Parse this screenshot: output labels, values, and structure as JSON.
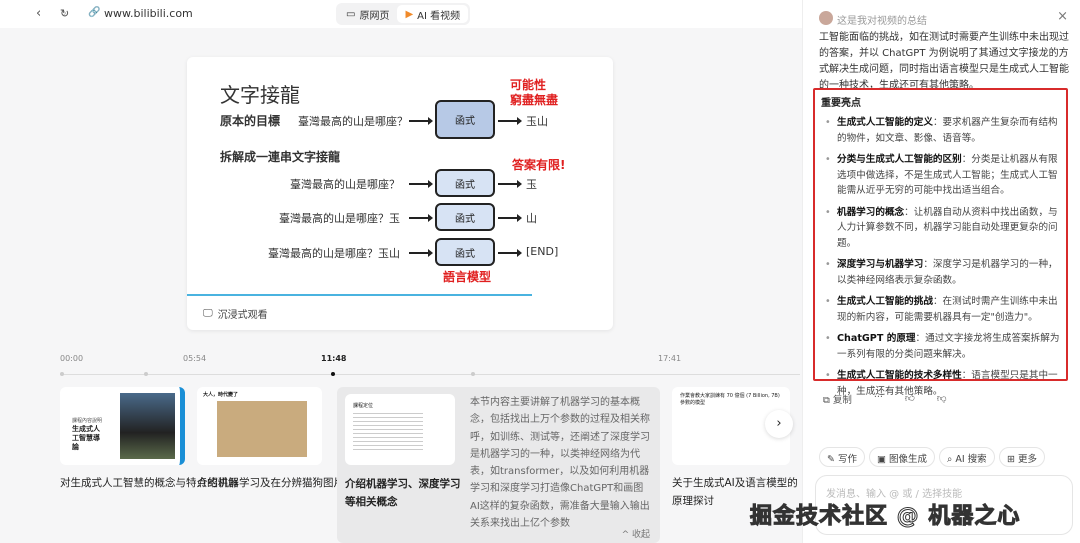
{
  "topbar": {
    "url": "www.bilibili.com",
    "tab_original": "原网页",
    "tab_ai": "AI 看视频"
  },
  "slide": {
    "title": "文字接龍",
    "goal_label": "原本的目標",
    "split_label": "拆解成一連串文字接龍",
    "question": "臺灣最高的山是哪座？",
    "q2": "臺灣最高的山是哪座？玉",
    "q3": "臺灣最高的山是哪座？玉山",
    "func": "函式",
    "out1": "玉山",
    "out2": "玉",
    "out3": "山",
    "out4": "[END]",
    "red1": "可能性",
    "red1b": "窮盡無盡",
    "red2": "答案有限!",
    "red3": "語言模型",
    "immersive": "沉浸式观看"
  },
  "timeline": {
    "marks": [
      "00:00",
      "05:54",
      "11:48",
      "17:41"
    ]
  },
  "cards": [
    {
      "title": "对生成式人工智慧的概念与特点的讲解",
      "thumb_head": "課程內容說明",
      "thumb_title": "生成式人工智慧導論"
    },
    {
      "title": "介绍机器学习及在分辨猫狗图片中的应用",
      "thumb_head": "大人，時代變了"
    },
    {
      "title": "介绍机器学习、深度学习等相关概念",
      "summary": "本节内容主要讲解了机器学习的基本概念，包括找出上万个参数的过程及相关称呼，如训练、测试等，还阐述了深度学习是机器学习的一种，以类神经网络为代表，如transformer，以及如何利用机器学习和深度学习打造像ChatGPT和画图AI这样的复杂函数，需准备大量输入输出关系来找出上亿个参数",
      "collapse": "收起",
      "thumb_head": "課程定位"
    },
    {
      "title": "关于生成式AI及语言模型的原理探讨",
      "thumb_head": "作業會教大家訓練有 70 億個 (7 Billion, 7B) 參數的模型"
    }
  ],
  "panel": {
    "header": "这是我对视频的总结",
    "intro": "工智能面临的挑战，如在测试时需要产生训练中未出现过的答案，并以 ChatGPT 为例说明了其通过文字接龙的方式解决生成问题，同时指出语言模型只是生成式人工智能的一种技术，生成还可有其他策略。",
    "highlights_title": "重要亮点",
    "highlights": [
      {
        "k": "生成式人工智能的定义",
        "v": "：要求机器产生复杂而有结构的物件，如文章、影像、语音等。"
      },
      {
        "k": "分类与生成式人工智能的区别",
        "v": "：分类是让机器从有限选项中做选择，不是生成式人工智能；生成式人工智能需从近乎无穷的可能中找出适当组合。"
      },
      {
        "k": "机器学习的概念",
        "v": "：让机器自动从资料中找出函数，与人力计算参数不同，机器学习能自动处理更复杂的问题。"
      },
      {
        "k": "深度学习与机器学习",
        "v": "：深度学习是机器学习的一种，以类神经网络表示复杂函数。"
      },
      {
        "k": "生成式人工智能的挑战",
        "v": "：在测试时需产生训练中未出现的新内容，可能需要机器具有一定\"创造力\"。"
      },
      {
        "k": "ChatGPT 的原理",
        "v": "：通过文字接龙将生成答案拆解为一系列有限的分类问题来解决。"
      },
      {
        "k": "生成式人工智能的技术多样性",
        "v": "：语言模型只是其中一种，生成还有其他策略。"
      }
    ],
    "copy": "复制",
    "chips": [
      "写作",
      "图像生成",
      "AI 搜索",
      "更多"
    ],
    "input_placeholder": "发消息、输入 @ 或 / 选择技能"
  },
  "watermark": "掘金技术社区 @ 机器之心"
}
